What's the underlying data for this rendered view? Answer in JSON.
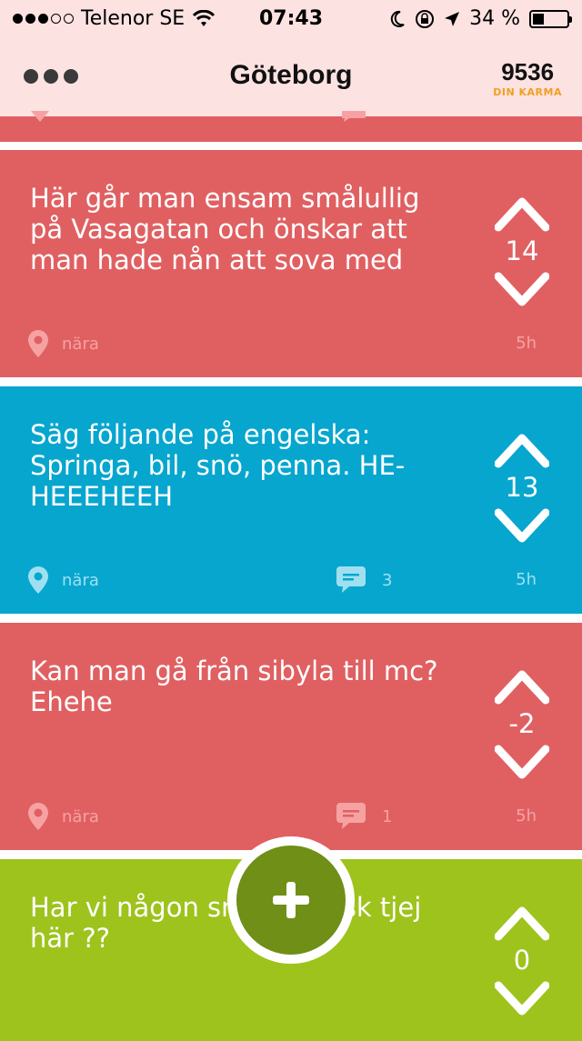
{
  "status_bar": {
    "carrier": "Telenor SE",
    "time": "07:43",
    "battery": "34 %",
    "battery_level": 0.34
  },
  "nav": {
    "title": "Göteborg",
    "karma_value": "9536",
    "karma_label": "DIN KARMA"
  },
  "colors": {
    "red": "#e06062",
    "blue": "#07a6cf",
    "green": "#9ec31c",
    "fab": "#6f8f17"
  },
  "posts": [
    {
      "text": "Här går man ensam smålullig på Vasagatan och önskar  att man hade nån att sova med",
      "votes": "14",
      "location": "nära",
      "comments": "",
      "time": "5h",
      "color": "#e06062"
    },
    {
      "text": "Säg följande på engelska: Springa, bil, snö, penna. HE-HEEEHEEH",
      "votes": "13",
      "location": "nära",
      "comments": "3",
      "time": "5h",
      "color": "#07a6cf"
    },
    {
      "text": "Kan man gå från sibyla till mc? Ehehe",
      "votes": "-2",
      "location": "nära",
      "comments": "1",
      "time": "5h",
      "color": "#e06062"
    },
    {
      "text": "Har vi någon snäll kurdisk tjej här ??",
      "votes": "0",
      "location": "",
      "comments": "",
      "time": "",
      "color": "#9ec31c"
    }
  ],
  "icons": {
    "location": "location-pin-icon",
    "comment": "comment-bubble-icon",
    "upvote": "chevron-up-icon",
    "downvote": "chevron-down-icon",
    "compose": "plus-icon",
    "menu": "more-dots-icon"
  }
}
